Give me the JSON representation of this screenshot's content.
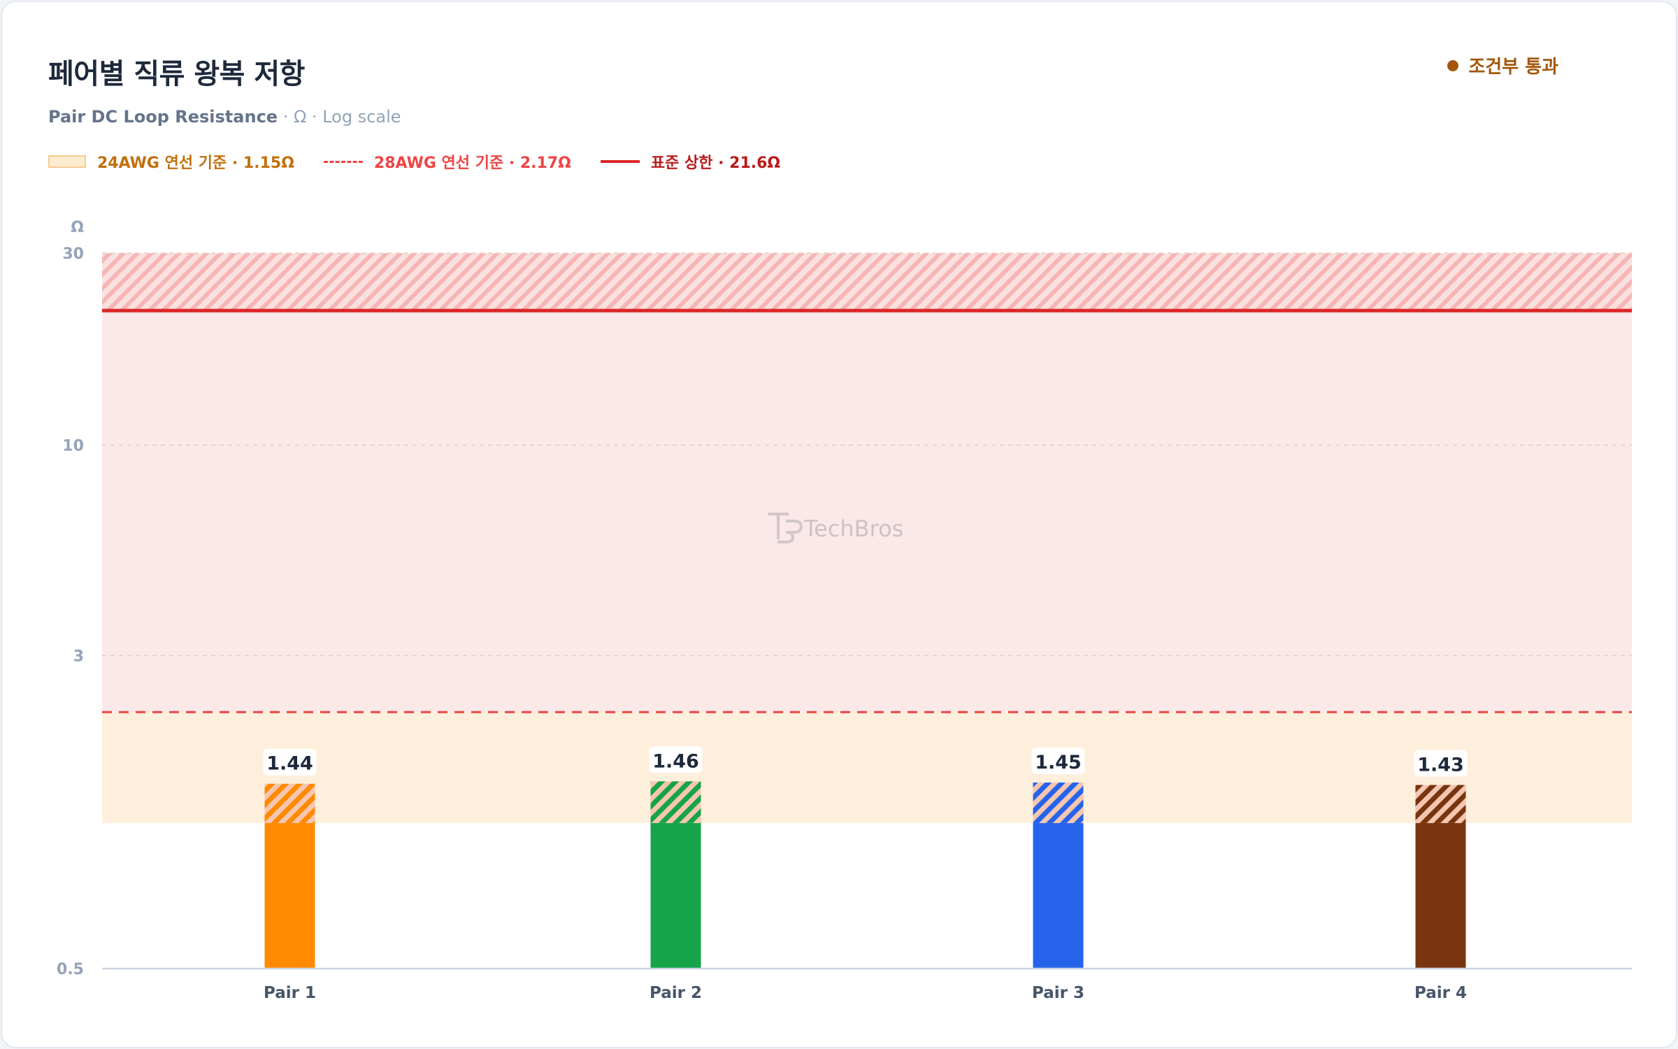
{
  "header": {
    "title": "페어별 직류 왕복 저항",
    "subtitle_main": "Pair DC Loop Resistance",
    "subtitle_rest": " · Ω · Log scale",
    "status_label": "조건부 통과"
  },
  "legend": {
    "band_label": "24AWG 연선 기준 · 1.15Ω",
    "dashed_label": "28AWG 연선 기준 · 2.17Ω",
    "limit_label": "표준 상한 · 21.6Ω"
  },
  "watermark": "TechBros",
  "colors": {
    "band": "#fdefdc",
    "danger_zone": "#fbe9e9",
    "dashed_line": "#ef4444",
    "limit_line": "#dc2626",
    "status": "#a3560a"
  },
  "chart_data": {
    "type": "bar",
    "scale": "log",
    "yunit": "Ω",
    "ylim": [
      0.5,
      30
    ],
    "yticks": [
      0.5,
      3,
      10,
      30
    ],
    "categories": [
      "Pair 1",
      "Pair 2",
      "Pair 3",
      "Pair 4"
    ],
    "values": [
      1.44,
      1.46,
      1.45,
      1.43
    ],
    "value_labels": [
      "1.44",
      "1.46",
      "1.45",
      "1.43"
    ],
    "bar_colors": [
      "#ff8a00",
      "#16a34a",
      "#2563eb",
      "#78350f"
    ],
    "reference_lines": [
      {
        "name": "24AWG 연선 기준",
        "value": 1.15,
        "style": "band"
      },
      {
        "name": "28AWG 연선 기준",
        "value": 2.17,
        "style": "dashed"
      },
      {
        "name": "표준 상한",
        "value": 21.6,
        "style": "solid"
      }
    ],
    "grid": true
  }
}
